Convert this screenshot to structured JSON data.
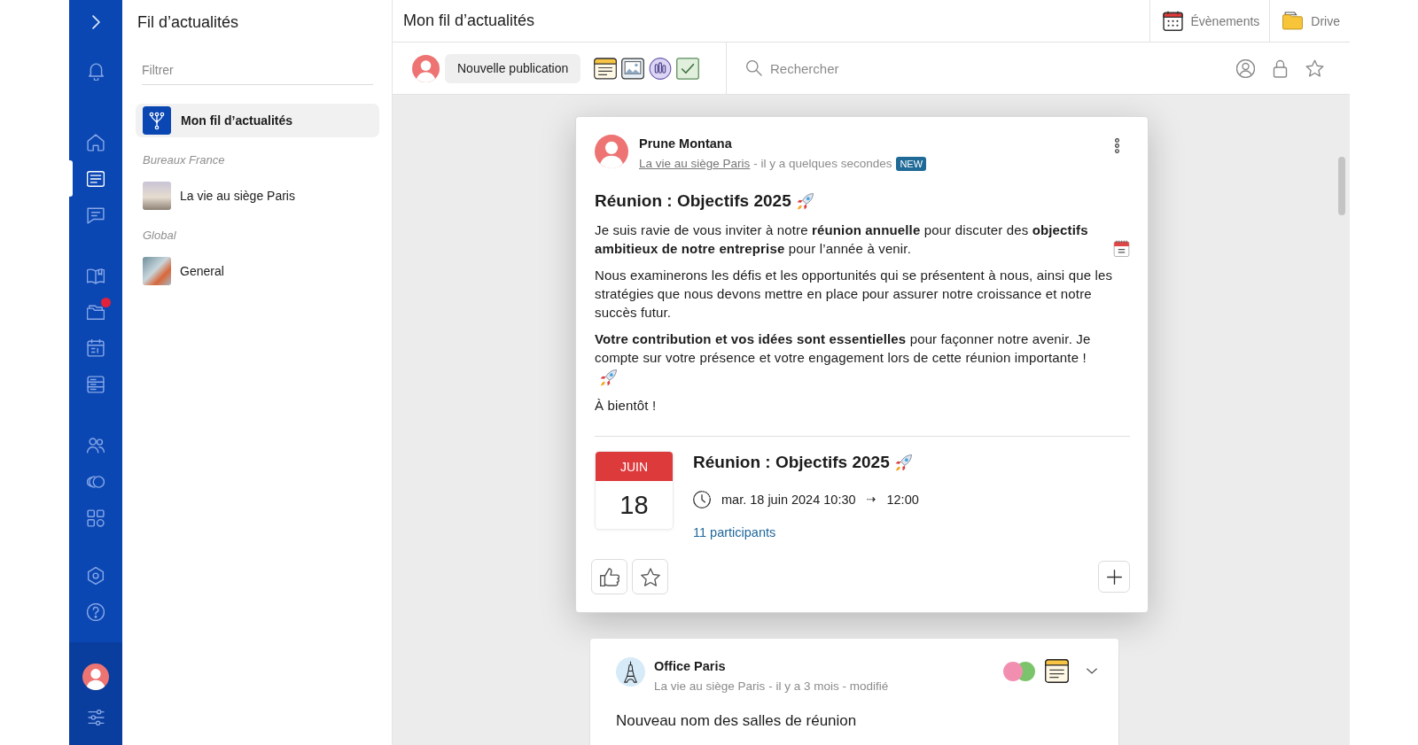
{
  "nav": {
    "items": [
      {
        "selected": false,
        "badge": false
      },
      {
        "selected": true,
        "badge": false
      },
      {
        "selected": false,
        "badge": false
      },
      {
        "selected": false,
        "badge": false
      },
      {
        "selected": false,
        "badge": true
      },
      {
        "selected": false,
        "badge": false
      },
      {
        "selected": false,
        "badge": false
      },
      {
        "selected": false,
        "badge": false
      },
      {
        "selected": false,
        "badge": false
      },
      {
        "selected": false,
        "badge": false
      },
      {
        "selected": false,
        "badge": false
      },
      {
        "selected": false,
        "badge": false
      }
    ]
  },
  "feed_panel": {
    "title": "Fil d’actualités",
    "filter": {
      "placeholder": "Filtrer"
    },
    "items": [
      {
        "label": "Mon fil d’actualités",
        "selected": true
      }
    ],
    "groups": [
      {
        "title": "Bureaux France",
        "items": [
          {
            "label": "La vie au siège Paris",
            "selected": false
          }
        ]
      },
      {
        "title": "Global",
        "items": [
          {
            "label": "General",
            "selected": false
          }
        ]
      }
    ]
  },
  "header": {
    "title": "Mon fil d’actualités",
    "links": [
      {
        "label": "Évènements"
      },
      {
        "label": "Drive"
      }
    ]
  },
  "toolbar": {
    "new_post_button": "Nouvelle publication",
    "search": {
      "placeholder": "Rechercher"
    },
    "filters": [
      {
        "selected": false
      },
      {
        "selected": false
      },
      {
        "selected": false
      }
    ]
  },
  "posts": [
    {
      "kind": "event",
      "author": "Prune Montana",
      "channel": {
        "label": "La vie au siège Paris",
        "link": true
      },
      "details": "- il y a quelques secondes",
      "badge": "NEW",
      "title": "Réunion : Objectifs 2025",
      "paragraphs": [
        "Je suis ravie de vous inviter à notre **réunion annuelle** pour discuter des **objectifs ambitieux de notre entreprise** pour l’année à venir.",
        "Nous examinerons les défis et les opportunités qui se présentent à nous, ainsi que les stratégies que nous devons mettre en place pour assurer notre croissance et notre succès futur.",
        "**Votre contribution et vos idées sont essentielles** pour façonner notre avenir. Je compte sur votre présence et votre engagement lors de cette réunion importante !",
        "À bientôt !"
      ],
      "event": {
        "month": "JUIN",
        "day": "18",
        "title": "Réunion : Objectifs 2025",
        "start": "mar. 18 juin 2024 10:30",
        "arrow": "⇢",
        "end": "12:00",
        "participants": "11 participants"
      },
      "actions": {
        "liked": false,
        "favorite": false
      }
    },
    {
      "kind": "text",
      "author": "Office Paris",
      "channel": {
        "label": "La vie au siège Paris",
        "link": false
      },
      "details": "- il y a 3 mois - modifié",
      "title": "Nouveau nom des salles de réunion"
    }
  ]
}
